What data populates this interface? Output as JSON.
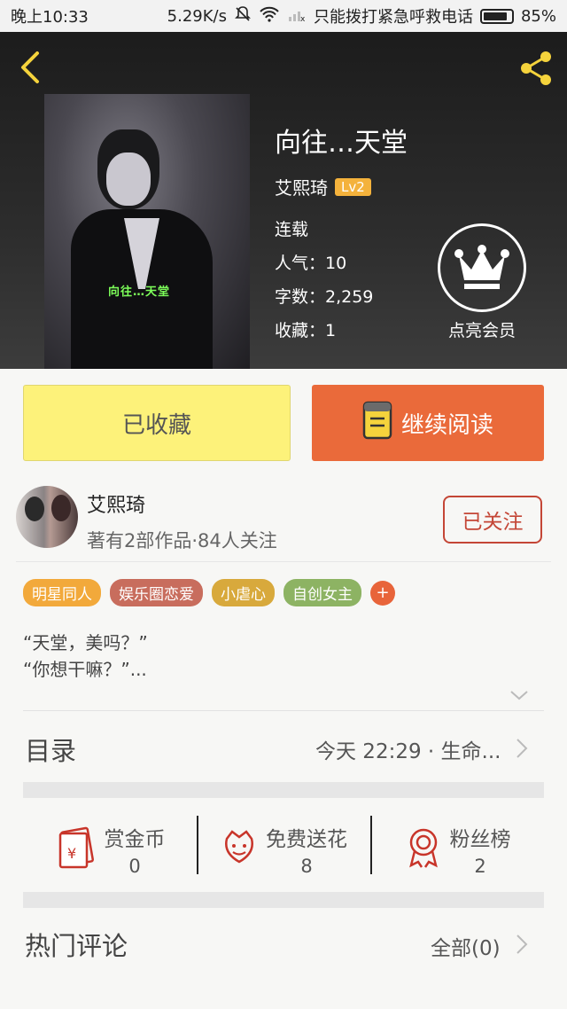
{
  "status_bar": {
    "time": "晚上10:33",
    "speed": "5.29K/s",
    "carrier": "只能拨打紧急呼救电话",
    "battery": "85%"
  },
  "header": {
    "back_icon": "back-arrow-icon",
    "share_icon": "share-icon",
    "cover_text": "向往…天堂",
    "title": "向往…天堂",
    "author": "艾熙琦",
    "level": "Lv2",
    "status": "连载",
    "popularity": "人气：10",
    "word_count": "字数：2,259",
    "favorites": "收藏：1",
    "vip_label": "点亮会员"
  },
  "actions": {
    "collected_label": "已收藏",
    "continue_label": "继续阅读"
  },
  "author_card": {
    "name": "艾熙琦",
    "stats": "著有2部作品·84人关注",
    "follow_label": "已关注"
  },
  "tags": [
    {
      "label": "明星同人",
      "color": "#f2a93b"
    },
    {
      "label": "娱乐圈恋爱",
      "color": "#c86d5d"
    },
    {
      "label": "小虐心",
      "color": "#d8a93c"
    },
    {
      "label": "自创女主",
      "color": "#8db363"
    }
  ],
  "tag_more": "+",
  "intro": {
    "line1": "“天堂，美吗？”",
    "line2": "“你想干嘛？”..."
  },
  "toc": {
    "title": "目录",
    "latest": "今天 22:29 · 生命..."
  },
  "stats": [
    {
      "label": "赏金币",
      "value": "0",
      "icon": "red-envelope-icon"
    },
    {
      "label": "免费送花",
      "value": "8",
      "icon": "flower-icon"
    },
    {
      "label": "粉丝榜",
      "value": "2",
      "icon": "medal-icon"
    }
  ],
  "comments": {
    "title": "热门评论",
    "all_label": "全部(0)"
  },
  "colors": {
    "collected_bg": "#fdf27a",
    "read_bg": "#ea6a3a",
    "follow_border": "#c44636",
    "accent_yellow": "#f5d33c"
  }
}
